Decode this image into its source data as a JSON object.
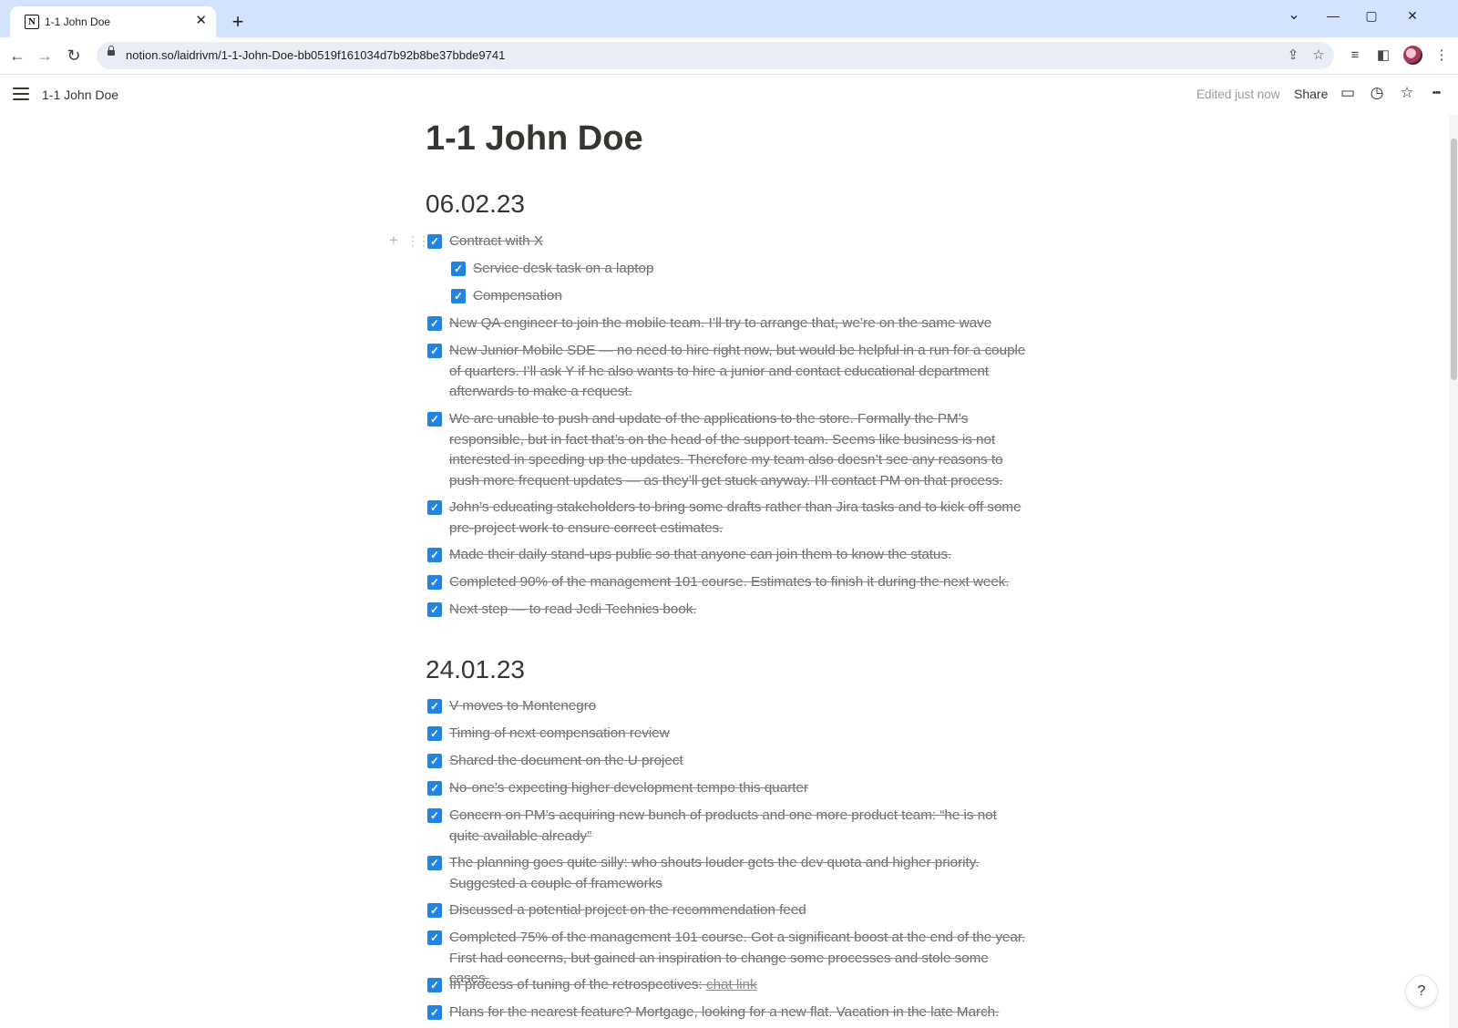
{
  "browser": {
    "tab_title": "1-1 John Doe",
    "tab_close": "✕",
    "new_tab": "+",
    "url": "notion.so/laidrivm/1-1-John-Doe-bb0519f161034d7b92b8be37bbde9741",
    "favicon_letter": "N"
  },
  "topbar": {
    "breadcrumb": "1-1 John Doe",
    "edited": "Edited just now",
    "share": "Share"
  },
  "page": {
    "title": "1-1 John Doe",
    "sections": [
      {
        "date": "06.02.23",
        "items": [
          {
            "text": "Contract with X",
            "checked": true
          },
          {
            "text": "Service desk task on a laptop",
            "checked": true,
            "nested": true
          },
          {
            "text": "Compensation",
            "checked": true,
            "nested": true
          },
          {
            "text": "New QA engineer to join the mobile team. I’ll try to arrange that, we’re on the same wave",
            "checked": true
          },
          {
            "text": "New Junior Mobile SDE — no need to hire right now, but would be helpful in a run for a couple of quarters. I’ll ask Y if he also wants to hire a junior and contact educational department afterwards to make a request.",
            "checked": true
          },
          {
            "text": "We are unable to push and update of the applications to the store. Formally the PM’s responsible, but in fact that’s on the head of the support team. Seems like business is not interested in speeding up the updates. Therefore my team also doesn’t see any reasons to push more frequent updates — as they’ll get stuck anyway. I’ll contact PM on that process.",
            "checked": true
          },
          {
            "text": "John’s educating stakeholders to bring some drafts rather than Jira tasks and to kick off some pre-project work to ensure correct estimates.",
            "checked": true
          },
          {
            "text": "Made their daily stand-ups public so that anyone can join them to know the status.",
            "checked": true
          },
          {
            "text": "Completed 90% of the management 101 course. Estimates to finish it during the next week.",
            "checked": true
          },
          {
            "text": "Next step — to read Jedi Technics book.",
            "checked": true
          }
        ]
      },
      {
        "date": "24.01.23",
        "items": [
          {
            "text": "V moves to Montenegro",
            "checked": true
          },
          {
            "text": "Timing of next compensation review",
            "checked": true
          },
          {
            "text": "Shared the document on the U project",
            "checked": true
          },
          {
            "text": "No-one’s expecting higher development tempo this quarter",
            "checked": true
          },
          {
            "text": "Concern on PM’s acquiring new bunch of products and one more product team: “he is not quite available already”",
            "checked": true
          },
          {
            "text": "The planning goes quite silly: who shouts louder gets the dev quota and higher priority. Suggested a couple of frameworks",
            "checked": true
          },
          {
            "text": "Discussed a potential project on the recommendation feed",
            "checked": true
          },
          {
            "text": "Completed 75% of the management 101 course. Got a significant boost at the end of the year. First had concerns, but gained an inspiration to change some processes and stole some cases.",
            "checked": true
          },
          {
            "text": "In process of tuning of the retrospectives: ",
            "link": "chat link",
            "checked": true
          },
          {
            "text": "Plans for the nearest feature? Mortgage, looking for a new flat. Vacation in the late March.",
            "checked": true
          }
        ]
      }
    ]
  },
  "help": "?",
  "accent_color": "#2383e2",
  "icons": {
    "back": "←",
    "forward": "→",
    "reload": "↻",
    "share_page": "⇪",
    "star": "☆",
    "media": "≡",
    "side_panel": "◧",
    "menu": "⋮",
    "minimize": "—",
    "maximize": "▢",
    "close": "✕",
    "tab_search": "⌄",
    "comment": "▭",
    "history": "◷",
    "favorite": "☆",
    "more": "•••",
    "add_block": "+",
    "drag": "⋮⋮",
    "check": "✓"
  }
}
